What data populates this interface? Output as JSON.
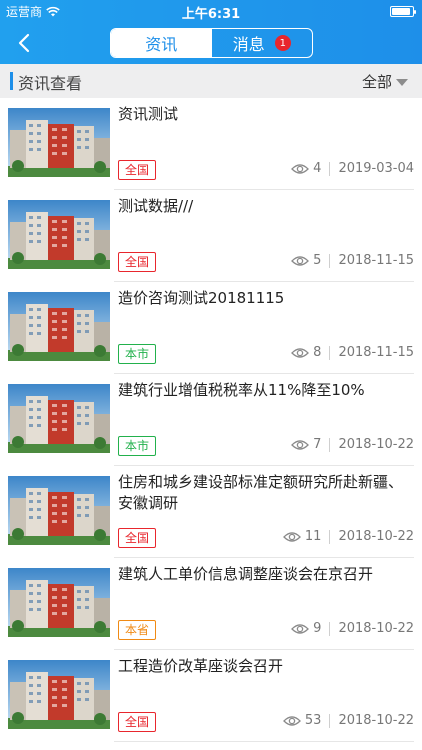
{
  "status_bar": {
    "carrier": "运营商",
    "time": "上午6:31",
    "battery_level": 0.9
  },
  "nav": {
    "back_icon": "chevron-left-icon",
    "tabs": [
      {
        "label": "资讯",
        "active": true
      },
      {
        "label": "消息",
        "active": false,
        "badge": "1"
      }
    ]
  },
  "section": {
    "title": "资讯查看",
    "filter_label": "全部"
  },
  "items": [
    {
      "title": "资讯测试",
      "tag": "全国",
      "tag_color": "#e8262d",
      "views": "4",
      "date": "2019-03-04"
    },
    {
      "title": "测试数据///",
      "tag": "全国",
      "tag_color": "#e8262d",
      "views": "5",
      "date": "2018-11-15"
    },
    {
      "title": "造价咨询测试20181115",
      "tag": "本市",
      "tag_color": "#22b14c",
      "views": "8",
      "date": "2018-11-15"
    },
    {
      "title": "建筑行业增值税税率从11%降至10%",
      "tag": "本市",
      "tag_color": "#22b14c",
      "views": "7",
      "date": "2018-10-22"
    },
    {
      "title": "住房和城乡建设部标准定额研究所赴新疆、安徽调研",
      "tag": "全国",
      "tag_color": "#e8262d",
      "views": "11",
      "date": "2018-10-22"
    },
    {
      "title": "建筑人工单价信息调整座谈会在京召开",
      "tag": "本省",
      "tag_color": "#f08a14",
      "views": "9",
      "date": "2018-10-22"
    },
    {
      "title": "工程造价改革座谈会召开",
      "tag": "全国",
      "tag_color": "#e8262d",
      "views": "53",
      "date": "2018-10-22"
    }
  ]
}
